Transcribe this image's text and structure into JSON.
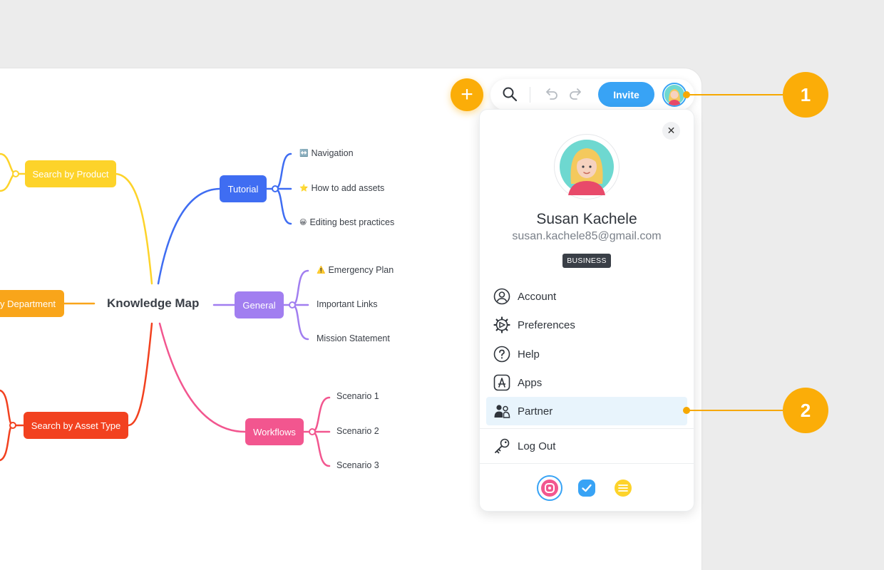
{
  "colors": {
    "page_bg": "#ececec",
    "accent_orange": "#fbad08",
    "invite_blue": "#38a3f5",
    "tutorial_blue": "#3f6df2",
    "general_purple": "#a17ef0",
    "workflows_pink": "#f2568f",
    "product_yellow": "#fdd32a",
    "department_orange": "#f9a51a",
    "asset_red": "#f2411f",
    "active_item_bg": "#e8f4fc"
  },
  "mindmap": {
    "central": "Knowledge Map",
    "nodes": {
      "product": "Search by Product",
      "department": "y Department",
      "asset_type": "Search by Asset Type",
      "tutorial": "Tutorial",
      "general": "General",
      "workflows": "Workflows"
    },
    "tutorial_leaves": [
      {
        "icon": "left-right-arrow-icon",
        "label": "Navigation"
      },
      {
        "icon": "star-icon",
        "label": "How to add assets"
      },
      {
        "icon": "smiley-icon",
        "label": "Editing best practices"
      }
    ],
    "general_leaves": [
      {
        "icon": "warning-icon",
        "label": "Emergency Plan"
      },
      {
        "icon": "",
        "label": "Important Links"
      },
      {
        "icon": "",
        "label": "Mission Statement"
      }
    ],
    "workflows_leaves": [
      {
        "label": "Scenario 1"
      },
      {
        "label": "Scenario 2"
      },
      {
        "label": "Scenario 3"
      }
    ]
  },
  "toolbar": {
    "add_label": "+",
    "search_icon": "search-icon",
    "undo_icon": "undo-icon",
    "redo_icon": "redo-icon",
    "invite_label": "Invite"
  },
  "profile": {
    "close_label": "✕",
    "name": "Susan Kachele",
    "email": "susan.kachele85@gmail.com",
    "plan_badge": "BUSINESS",
    "menu": [
      {
        "icon": "user-circle-icon",
        "label": "Account"
      },
      {
        "icon": "gear-icon",
        "label": "Preferences"
      },
      {
        "icon": "help-icon",
        "label": "Help"
      },
      {
        "icon": "apps-icon",
        "label": "Apps"
      },
      {
        "icon": "partner-icon",
        "label": "Partner"
      },
      {
        "icon": "key-icon",
        "label": "Log Out"
      }
    ],
    "active_item": "Partner",
    "apps": [
      "mindmeister-app-icon",
      "meistertask-app-icon",
      "meisternote-app-icon"
    ]
  },
  "callouts": [
    "1",
    "2"
  ]
}
